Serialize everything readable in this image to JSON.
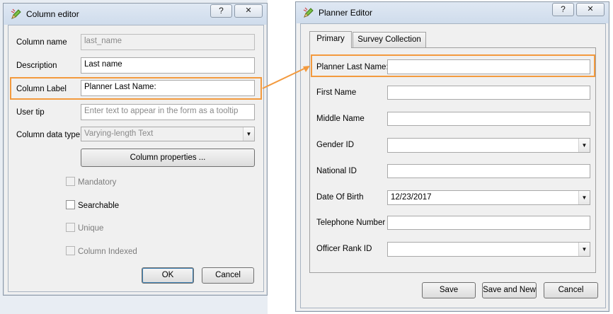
{
  "column_editor": {
    "title": "Column editor",
    "help_label": "?",
    "close_label": "✕",
    "labels": {
      "column_name": "Column name",
      "description": "Description",
      "column_label": "Column Label",
      "user_tip": "User tip",
      "column_data_type": "Column data type"
    },
    "values": {
      "column_name": "last_name",
      "description": "Last name",
      "column_label": "Planner Last Name:",
      "user_tip_placeholder": "Enter text to appear in the form as a tooltip",
      "column_data_type": "Varying-length Text"
    },
    "column_properties_label": "Column properties ...",
    "checkboxes": {
      "mandatory": "Mandatory",
      "searchable": "Searchable",
      "unique": "Unique",
      "column_indexed": "Column Indexed"
    },
    "ok_label": "OK",
    "cancel_label": "Cancel"
  },
  "planner_editor": {
    "title": "Planner Editor",
    "help_label": "?",
    "close_label": "✕",
    "tabs": [
      "Primary",
      "Survey Collection"
    ],
    "fields": {
      "last_name": "Planner Last Name:",
      "first_name": "First Name",
      "middle_name": "Middle Name",
      "gender_id": "Gender ID",
      "national_id": "National ID",
      "date_of_birth": "Date Of Birth",
      "telephone_number": "Telephone Number",
      "officer_rank_id": "Officer Rank ID"
    },
    "date_of_birth_value": "12/23/2017",
    "save_label": "Save",
    "save_and_new_label": "Save and New",
    "cancel_label": "Cancel"
  },
  "colors": {
    "highlight": "#f39a3e",
    "title_bar": "#dfe8f3"
  }
}
